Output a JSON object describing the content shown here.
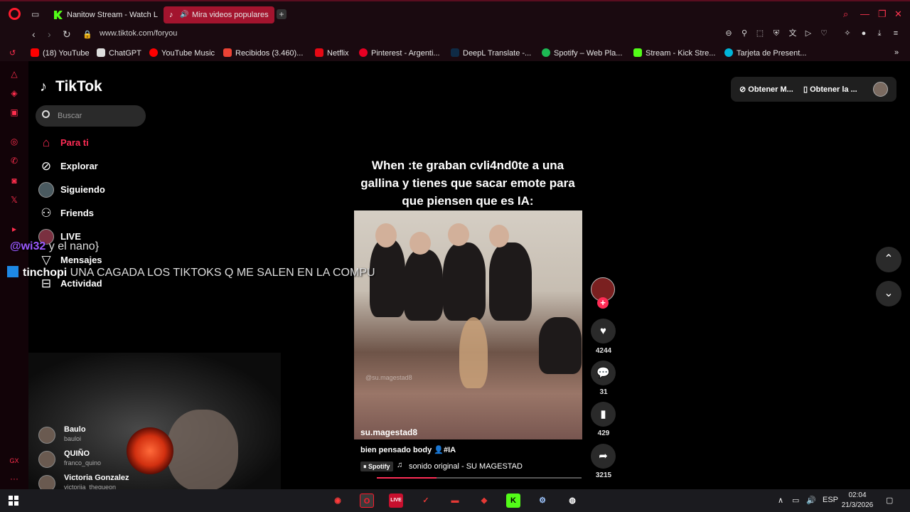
{
  "browser": {
    "tabs": [
      {
        "title": "Nanitow Stream - Watch L",
        "favicon": "kick-icon"
      },
      {
        "title": "Mira videos populares",
        "favicon": "tiktok-icon",
        "active": true
      }
    ],
    "url": "www.tiktok.com/foryou",
    "bookmarks": [
      {
        "label": "(18) YouTube",
        "color": "#ff0000"
      },
      {
        "label": "ChatGPT",
        "color": "#ffffff"
      },
      {
        "label": "YouTube Music",
        "color": "#ff0000"
      },
      {
        "label": "Recibidos (3.460)...",
        "color": "#ea4335"
      },
      {
        "label": "Netflix",
        "color": "#e50914"
      },
      {
        "label": "Pinterest - Argenti...",
        "color": "#e60023"
      },
      {
        "label": "DeepL Translate -...",
        "color": "#0f2b46"
      },
      {
        "label": "Spotify – Web Pla...",
        "color": "#1db954"
      },
      {
        "label": "Stream - Kick Stre...",
        "color": "#53fc18"
      },
      {
        "label": "Tarjeta de Present...",
        "color": "#00b4d8"
      }
    ]
  },
  "tiktok": {
    "logo": "TikTok",
    "search_placeholder": "Buscar",
    "menu": [
      {
        "label": "Para ti",
        "icon": "home-icon"
      },
      {
        "label": "Explorar",
        "icon": "compass-icon"
      },
      {
        "label": "Siguiendo",
        "icon": "following-avatar"
      },
      {
        "label": "Friends",
        "icon": "friends-icon"
      },
      {
        "label": "LIVE",
        "icon": "live-avatar"
      },
      {
        "label": "Mensajes",
        "icon": "send-icon"
      },
      {
        "label": "Actividad",
        "icon": "activity-icon"
      }
    ],
    "top_bar": {
      "get_app_1": "Obtener M...",
      "get_app_2": "Obtener la ..."
    },
    "video": {
      "caption": "When :te graban cvli4nd0te  a una gallina y tienes que sacar emote para que piensen que es IA:",
      "username": "su.magestad8",
      "watermark": "@su.magestad8",
      "description": "bien pensado body 👤#IA",
      "spotify_tag": "Spotify",
      "sound": "sonido original - SU MAGESTAD",
      "progress": 0.29,
      "likes": "4244",
      "comments": "31",
      "saves": "429",
      "shares": "3215"
    },
    "following": [
      {
        "name": "Baulo",
        "handle": "bauloi"
      },
      {
        "name": "QUIÑO",
        "handle": "franco_quino"
      },
      {
        "name": "Victoria Gonzalez",
        "handle": "victoriia_thegueon"
      }
    ]
  },
  "stream_overlay": {
    "chat": [
      {
        "user": "@wi32",
        "message": "y el nano}"
      },
      {
        "user": "tinchopi",
        "message": "UNA CAGADA LOS TIKTOKS Q ME SALEN EN LA COMPU"
      }
    ]
  },
  "taskbar": {
    "language": "ESP",
    "time": "02:04",
    "date": "21/3/2026"
  }
}
